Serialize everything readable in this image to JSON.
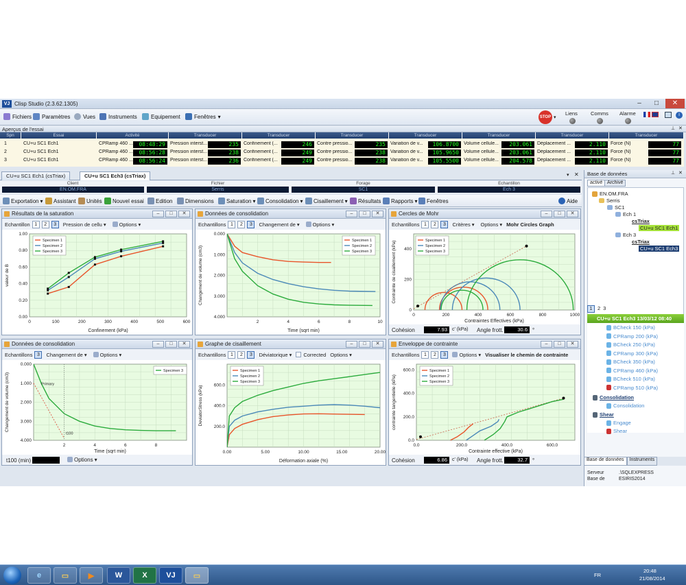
{
  "window": {
    "title": "Clisp Studio (2.3.62.1305)"
  },
  "menu": {
    "items": [
      "Fichiers",
      "Paramètres",
      "Vues",
      "Instruments",
      "Equipement",
      "Fenêtres"
    ],
    "stop": "STOP",
    "liens": "Liens",
    "comms": "Comms",
    "alarme": "Alarme"
  },
  "apercu": {
    "title": "Aperçus de l'essai",
    "headers": [
      "Spn",
      "Essai",
      "Activité",
      "Transducer",
      "Transducer",
      "Transducer",
      "Transducer",
      "Transducer",
      "Transducer",
      "Transducer"
    ],
    "rows": [
      {
        "spn": "1",
        "essai": "CU+u SC1 Ech1",
        "act": "CPRamp 460 ...",
        "time": "08:48:29",
        "t1": "Pression interst...",
        "v1": "235",
        "t2": "Confinement (...",
        "v2": "246",
        "t3": "Contre pressio...",
        "v3": "235",
        "t4": "Variation de v...",
        "v4": "106.8700",
        "t5": "Volume cellule...",
        "v5": "203.061",
        "t6": "Déplacement ...",
        "v6": "2.110",
        "t7": "Force (N)",
        "v7": "77"
      },
      {
        "spn": "2",
        "essai": "CU+u SC1 Ech1",
        "act": "CPRamp 460 ...",
        "time": "08:56:28",
        "t1": "Pression interst...",
        "v1": "238",
        "t2": "Confinement (...",
        "v2": "249",
        "t3": "Contre pressio...",
        "v3": "238",
        "t4": "Variation de v...",
        "v4": "105.9650",
        "t5": "Volume cellule...",
        "v5": "203.061",
        "t6": "Déplacement ...",
        "v6": "2.110",
        "t7": "Force (N)",
        "v7": "77"
      },
      {
        "spn": "3",
        "essai": "CU+u SC1 Ech1",
        "act": "CPRamp 460 ...",
        "time": "08:56:24",
        "t1": "Pression interst...",
        "v1": "236",
        "t2": "Confinement (...",
        "v2": "249",
        "t3": "Contre pressio...",
        "v3": "238",
        "t4": "Variation de v...",
        "v4": "105.5500",
        "t5": "Volume cellule...",
        "v5": "204.578",
        "t6": "Déplacement ...",
        "v6": "2.110",
        "t7": "Force (N)",
        "v7": "77"
      }
    ]
  },
  "doctabs": [
    "CU+u SC1 Ech1 (csTriax)",
    "CU+u SC1 Ech3 (csTriax)"
  ],
  "info": {
    "client_label": "Client",
    "client": "EN.OM.FRA",
    "fichier_label": "Fichier",
    "fichier": "Serris",
    "forage_label": "Forage",
    "forage": "SC1",
    "echantillon_label": "Echantillon",
    "echantillon": "Ech 3"
  },
  "toolbar": [
    "Exportation",
    "Assistant",
    "Unités",
    "Nouvel essai",
    "Edition",
    "Dimensions",
    "Saturation",
    "Consolidation",
    "Cisaillement",
    "Résultats",
    "Rapports",
    "Fenêtres",
    "Aide"
  ],
  "common": {
    "echantillon": "Echantillon",
    "echantillons": "Echantillons",
    "options": "Options",
    "s1": "1",
    "s2": "2",
    "s3": "3",
    "specimen1": "Specimen 1",
    "specimen2": "Specimen 2",
    "specimen3": "Specimen 3"
  },
  "panels": {
    "p1": {
      "title": "Résultats de la saturation",
      "dropdown": "Pression de cellu"
    },
    "p2": {
      "title": "Données de consolidation",
      "dropdown": "Changement de"
    },
    "p3": {
      "title": "Cercles de Mohr",
      "criteria": "Critères",
      "graphtitle": "Mohr Circles Graph",
      "cohesion_label": "Cohésion",
      "cohesion": "7.93",
      "cohesion_unit": "c' (kPa)",
      "angle_label": "Angle frott.",
      "angle": "30.6",
      "angle_unit": "°"
    },
    "p4": {
      "title": "Données de consolidation",
      "dropdown": "Changement de",
      "t100_label": "t100 (min)",
      "primary": "Primary",
      "t100": "t100"
    },
    "p5": {
      "title": "Graphe de cisaillement",
      "dropdown": "Déviatorique",
      "corrected": "Corrected"
    },
    "p6": {
      "title": "Enveloppe de contrainte",
      "graphtitle": "Visualiser le chemin de contrainte",
      "cohesion_label": "Cohésion",
      "cohesion": "6.86",
      "cohesion_unit": "c' (kPa)",
      "angle_label": "Angle frott.",
      "angle": "32.7",
      "angle_unit": "°"
    }
  },
  "chart_data": [
    {
      "id": "saturation",
      "type": "line",
      "xlabel": "Confinement (kPa)",
      "ylabel": "valeur de B",
      "xlim": [
        0,
        600
      ],
      "ylim": [
        0.0,
        1.0
      ],
      "xticks": [
        "0",
        "100",
        "200",
        "300",
        "400",
        "500",
        "600"
      ],
      "yticks": [
        "0.00",
        "0.20",
        "0.40",
        "0.60",
        "0.80",
        "1.00"
      ],
      "series": [
        {
          "name": "Specimen 1",
          "color": "#e8542a",
          "x": [
            70,
            150,
            250,
            350,
            510
          ],
          "y": [
            0.28,
            0.36,
            0.63,
            0.73,
            0.85
          ]
        },
        {
          "name": "Specimen 2",
          "color": "#4a88b8",
          "x": [
            70,
            150,
            250,
            350,
            510
          ],
          "y": [
            0.32,
            0.48,
            0.7,
            0.79,
            0.89
          ]
        },
        {
          "name": "Specimen 3",
          "color": "#2bab3c",
          "x": [
            70,
            150,
            250,
            350,
            510
          ],
          "y": [
            0.34,
            0.53,
            0.72,
            0.81,
            0.91
          ]
        }
      ]
    },
    {
      "id": "consolidation",
      "type": "line",
      "xlabel": "Time (sqrt min)",
      "ylabel": "Changement de volume (cm3)",
      "xlim": [
        0,
        10
      ],
      "ylim": [
        0,
        4
      ],
      "xticks": [
        "2",
        "4",
        "6",
        "8",
        "10"
      ],
      "yticks": [
        "0.000",
        "1.000",
        "2.000",
        "3.000",
        "4.000"
      ],
      "series": [
        {
          "name": "Specimen 1",
          "color": "#e8542a",
          "x": [
            0,
            0.5,
            1,
            2,
            3,
            4,
            5,
            6,
            6.8
          ],
          "y": [
            0,
            0.6,
            0.9,
            1.1,
            1.25,
            1.33,
            1.36,
            1.38,
            1.38
          ]
        },
        {
          "name": "Specimen 2",
          "color": "#4a88b8",
          "x": [
            0,
            0.5,
            1,
            2,
            3,
            4,
            5,
            6,
            7,
            8,
            9.7
          ],
          "y": [
            0,
            0.9,
            1.4,
            1.9,
            2.2,
            2.4,
            2.55,
            2.65,
            2.72,
            2.76,
            2.78
          ]
        },
        {
          "name": "Specimen 3",
          "color": "#2bab3c",
          "x": [
            0,
            0.5,
            1,
            2,
            3,
            4,
            5,
            6,
            7,
            8,
            9.5
          ],
          "y": [
            0,
            1.2,
            1.8,
            2.5,
            2.9,
            3.15,
            3.3,
            3.38,
            3.42,
            3.44,
            3.45
          ]
        }
      ]
    },
    {
      "id": "mohr",
      "type": "line",
      "xlabel": "Contraintes Effectives (kPa)",
      "ylabel": "Contrainte de cisaillement (kPa)",
      "xlim": [
        0,
        1000
      ],
      "ylim": [
        0,
        500
      ],
      "xticks": [
        "0",
        "200",
        "400",
        "600",
        "800",
        "1000"
      ],
      "yticks": [
        "0",
        "200",
        "400"
      ],
      "circles": [
        {
          "name": "Specimen 1",
          "color": "#e8542a",
          "center": [
            185,
            0
          ],
          "radius": 115
        },
        {
          "name": "Specimen 1",
          "color": "#e8542a",
          "center": [
            310,
            0
          ],
          "radius": 150
        },
        {
          "name": "Specimen 2",
          "color": "#4a88b8",
          "center": [
            350,
            0
          ],
          "radius": 185
        },
        {
          "name": "Specimen 2",
          "color": "#4a88b8",
          "center": [
            450,
            0
          ],
          "radius": 210
        },
        {
          "name": "Specimen 3",
          "color": "#2bab3c",
          "center": [
            300,
            0
          ],
          "radius": 130
        },
        {
          "name": "Specimen 3",
          "color": "#2bab3c",
          "center": [
            660,
            0
          ],
          "radius": 330
        }
      ],
      "envelope": {
        "x": [
          0,
          700
        ],
        "y": [
          7.93,
          420
        ]
      }
    },
    {
      "id": "consolidation2",
      "type": "line",
      "xlabel": "Time (sqrt min)",
      "ylabel": "Changement de volume (cm3)",
      "xlim": [
        0,
        10
      ],
      "ylim": [
        0,
        4
      ],
      "xticks": [
        "2",
        "4",
        "6",
        "8"
      ],
      "yticks": [
        "0.000",
        "1.000",
        "2.000",
        "3.000",
        "4.000"
      ],
      "series": [
        {
          "name": "Specimen 3",
          "color": "#2bab3c",
          "x": [
            0,
            0.5,
            1,
            2,
            3,
            4,
            5,
            6,
            7,
            8,
            9.3
          ],
          "y": [
            0,
            1.0,
            1.8,
            2.6,
            3.0,
            3.25,
            3.38,
            3.45,
            3.48,
            3.5,
            3.5
          ]
        }
      ]
    },
    {
      "id": "shear",
      "type": "line",
      "xlabel": "Déformation axiale (%)",
      "ylabel": "DeviatorStress (kPa)",
      "xlim": [
        0,
        20
      ],
      "ylim": [
        0,
        800
      ],
      "xticks": [
        "0.00",
        "5.00",
        "10.00",
        "15.00",
        "20.00"
      ],
      "yticks": [
        "200.0",
        "400.0",
        "600.0"
      ],
      "series": [
        {
          "name": "Specimen 1",
          "color": "#e8542a",
          "x": [
            0,
            0.3,
            1,
            2,
            4,
            6,
            8,
            10,
            12,
            15,
            18
          ],
          "y": [
            0,
            120,
            180,
            220,
            265,
            295,
            310,
            320,
            322,
            318,
            315
          ]
        },
        {
          "name": "Specimen 2",
          "color": "#4a88b8",
          "x": [
            0,
            0.3,
            1,
            2,
            4,
            6,
            8,
            10,
            12,
            14,
            16,
            18,
            20
          ],
          "y": [
            0,
            200,
            260,
            300,
            340,
            365,
            385,
            395,
            405,
            410,
            405,
            395,
            380
          ]
        },
        {
          "name": "Specimen 3",
          "color": "#2bab3c",
          "x": [
            0,
            0.3,
            1,
            2,
            4,
            6,
            8,
            10,
            12,
            14,
            16,
            18,
            20
          ],
          "y": [
            0,
            300,
            380,
            440,
            500,
            545,
            580,
            615,
            640,
            660,
            680,
            700,
            720
          ]
        }
      ]
    },
    {
      "id": "envelope",
      "type": "line",
      "xlabel": "Contrainte effective (kPa)",
      "ylabel": "contrainte tangentielle (kPa)",
      "xlim": [
        0,
        700
      ],
      "ylim": [
        0,
        650
      ],
      "xticks": [
        "0.0",
        "200.0",
        "400.0",
        "600.0"
      ],
      "yticks": [
        "0.0",
        "200.0",
        "400.0",
        "600.0"
      ],
      "series": [
        {
          "name": "Specimen 1",
          "color": "#e8542a",
          "x": [
            150,
            180,
            210,
            230,
            250
          ],
          "y": [
            0,
            30,
            70,
            110,
            140
          ]
        },
        {
          "name": "Specimen 2",
          "color": "#4a88b8",
          "x": [
            220,
            250,
            280,
            330,
            360,
            365
          ],
          "y": [
            0,
            40,
            80,
            120,
            160,
            180
          ]
        },
        {
          "name": "Specimen 3",
          "color": "#2bab3c",
          "x": [
            300,
            340,
            370,
            390,
            400,
            450,
            500,
            550,
            600,
            650
          ],
          "y": [
            0,
            50,
            100,
            160,
            200,
            240,
            270,
            300,
            330,
            350
          ]
        }
      ],
      "envelope": {
        "x": [
          0,
          650
        ],
        "y": [
          6.86,
          360
        ]
      }
    }
  ],
  "side": {
    "title": "Base de données",
    "tab_active": "activé",
    "tab_archive": "Archivé",
    "tree": [
      "EN.OM.FRA",
      "Serris",
      "SC1",
      "Ech 1",
      "csTriax",
      "CU+u SC1 Ech1",
      "Ech 3",
      "csTriax",
      "CU+u SC1 Ech3"
    ],
    "pages": [
      "1",
      "2",
      "3"
    ],
    "selected": "CU+u SC1 Ech3 13/03/12 08:40",
    "steps": [
      "BCheck 150 (kPa)",
      "CPRamp 200 (kPa)",
      "BCheck 250 (kPa)",
      "CPRamp 300 (kPa)",
      "BCheck 350 (kPa)",
      "CPRamp 460 (kPa)",
      "BCheck 510 (kPa)",
      "CPRamp 510 (kPa)"
    ],
    "consolidation": "Consolidation",
    "consolidation_item": "Consolidation",
    "shear": "Shear",
    "engage": "Engage",
    "shear_item": "Shear",
    "serveur_label": "Serveur",
    "serveur": ".\\SQLEXPRESS",
    "base_label": "Base de",
    "base": "ESIRIS2014",
    "btn_db": "Base de données",
    "btn_inst": "Instruments"
  },
  "taskbar": {
    "lang": "FR",
    "time": "20:48",
    "date": "21/08/2014"
  }
}
